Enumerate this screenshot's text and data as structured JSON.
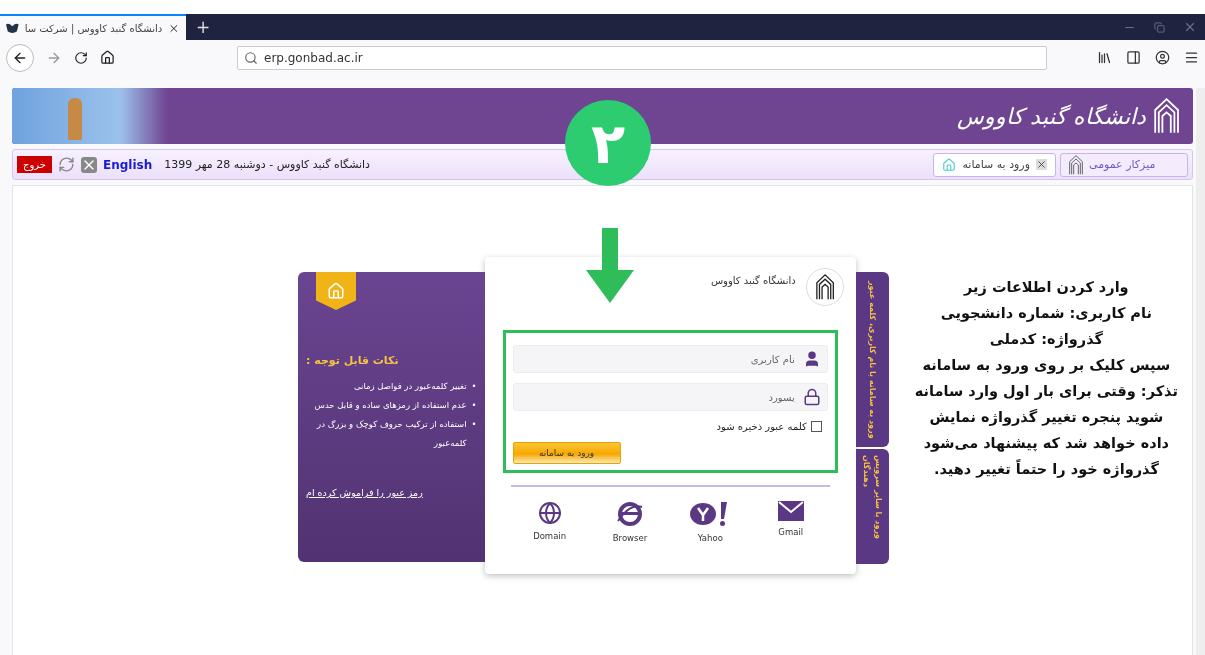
{
  "browser": {
    "tab_title": "دانشگاه گنبد کاووس | شرکت سا",
    "new_tab": "+",
    "url": "erp.gonbad.ac.ir"
  },
  "banner": {
    "logo_text": "دانشگاه گنبد کاووس",
    "step_badge": "۲"
  },
  "nav": {
    "tabs": [
      {
        "label": "میزکار عمومی",
        "selected": false
      },
      {
        "label": "ورود به سامانه",
        "selected": true
      }
    ],
    "date_line": "دانشگاه گنبد کاووس - دوشنبه 28 مهر 1399",
    "language": "English",
    "logout": "خروج"
  },
  "notes_panel": {
    "title": "نکات قابل توجه :",
    "bullet": "•",
    "items": [
      "تغییر کلمه‌عبور در فواصل زمانی",
      "عدم استفاده از رمزهای ساده و قابل حدس",
      "استفاده از ترکیب حروف کوچک و بزرگ در کلمه‌عبور"
    ],
    "forgot_link": "رمز عبور را فراموش کرده ام"
  },
  "login": {
    "org_name": "دانشگاه گنبد کاووس",
    "username": {
      "placeholder": "نام کاربری"
    },
    "password": {
      "placeholder": "پسورد"
    },
    "remember": {
      "label": "کلمه عبور ذخیره شود",
      "checked": false
    },
    "submit": "ورود به سامانه",
    "providers": [
      {
        "kind": "gmail",
        "label": "Gmail"
      },
      {
        "kind": "yahoo",
        "label": "Yahoo"
      },
      {
        "kind": "browser",
        "label": "Browser"
      },
      {
        "kind": "domain",
        "label": "Domain"
      }
    ]
  },
  "side_tabs": [
    "ورود به سامانه با نام کاربری، کلمه عبور",
    "ورود با سایر سرویس دهندگان"
  ],
  "instructions": [
    "وارد کردن اطلاعات زیر",
    "نام کاربری: شماره دانشجویی",
    "گذرواژه: کدملی",
    "سپس کلیک بر روی ورود به سامانه",
    "تذکر: وقتی برای بار اول وارد سامانه",
    "شوید پنجره تغییر گذرواژه نمایش",
    "داده خواهد شد که پیشنهاد می‌شود",
    "گذرواژه خود را حتماً تغییر دهید."
  ]
}
